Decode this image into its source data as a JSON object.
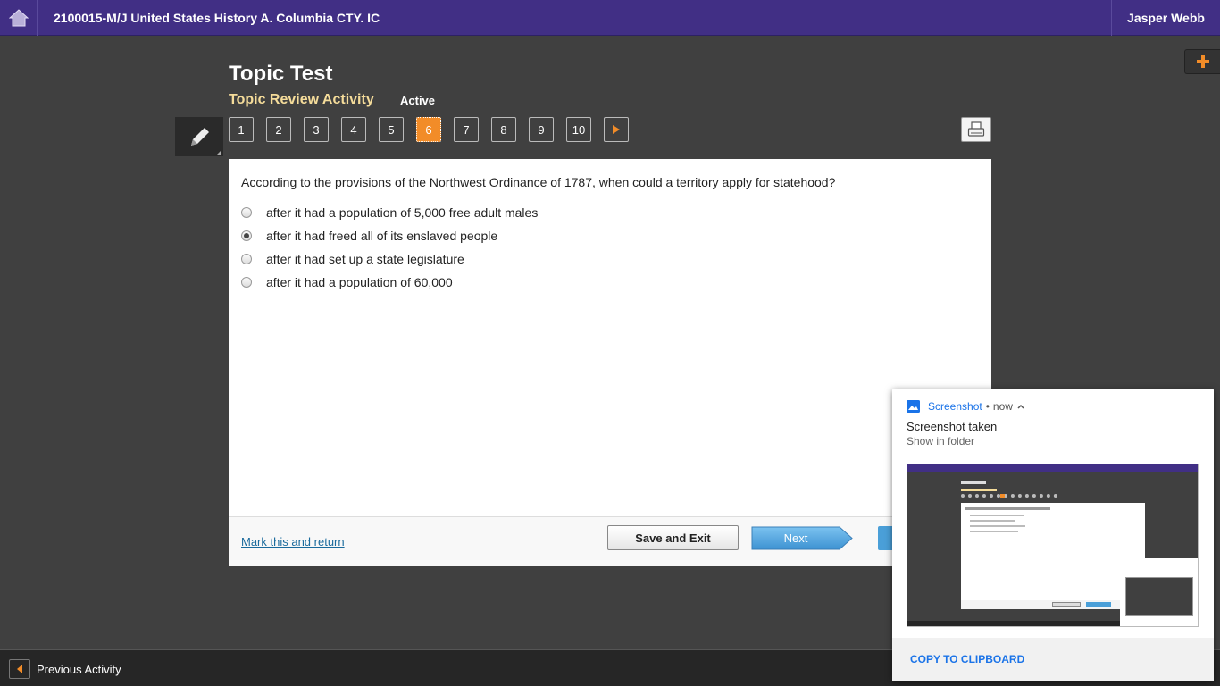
{
  "topbar": {
    "course_title": "2100015-M/J United States History A. Columbia CTY. IC",
    "user_name": "Jasper Webb"
  },
  "header": {
    "title": "Topic Test",
    "activity": "Topic Review Activity",
    "status": "Active"
  },
  "question_nav": {
    "items": [
      "1",
      "2",
      "3",
      "4",
      "5",
      "6",
      "7",
      "8",
      "9",
      "10"
    ],
    "current": "6"
  },
  "question": {
    "text": "According to the provisions of the Northwest Ordinance of 1787, when could a territory apply for statehood?",
    "options": [
      "after it had a population of 5,000 free adult males",
      "after it had freed all of its enslaved people",
      "after it had set up a state legislature",
      "after it had a population of 60,000"
    ],
    "selected_index": 1
  },
  "footer": {
    "mark_return": "Mark this and return",
    "save_exit": "Save and Exit",
    "next": "Next"
  },
  "bottombar": {
    "previous_activity": "Previous Activity"
  },
  "notification": {
    "app_name": "Screenshot",
    "separator": "•",
    "time": "now",
    "title": "Screenshot taken",
    "subtitle": "Show in folder",
    "action": "COPY TO CLIPBOARD"
  },
  "colors": {
    "topbar": "#412f85",
    "accent": "#f28c28",
    "activity": "#f5dc9a",
    "next": "#4a9fd8",
    "link": "#1a73e8"
  },
  "icons": {
    "home": "home-icon",
    "plus": "plus-icon",
    "pencil": "pencil-icon",
    "print": "print-icon",
    "next": "play-arrow-icon",
    "previous": "back-arrow-icon",
    "notification_app": "image-icon"
  }
}
